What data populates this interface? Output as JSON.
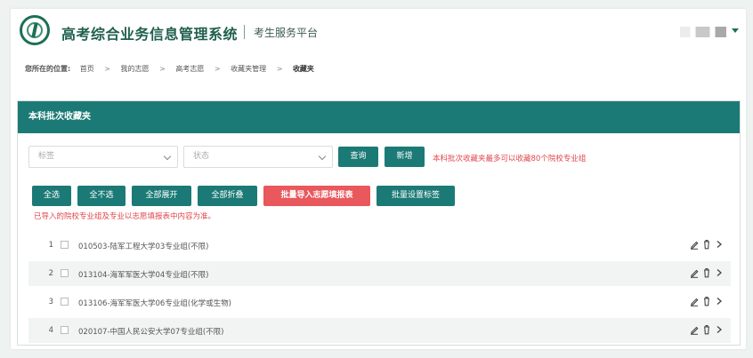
{
  "colors": {
    "accent": "#1c7a76",
    "title": "#1f5f4d",
    "danger": "#e8585d",
    "hint": "#e0464b"
  },
  "header": {
    "title": "高考综合业务信息管理系统",
    "subtitle": "考生服务平台",
    "logo_icon": "emblem-logo",
    "user_menu_icon": "caret-down-icon"
  },
  "breadcrumb": {
    "prefix": "您所在的位置:",
    "items": [
      "首页",
      "我的志愿",
      "高考志愿",
      "收藏夹管理",
      "收藏夹"
    ],
    "separator": ">"
  },
  "panel": {
    "title": "本科批次收藏夹",
    "filters": {
      "tag_placeholder": "标签",
      "status_placeholder": "状态"
    },
    "query_button": "查询",
    "add_button": "新增",
    "limit_hint": "本科批次收藏夹最多可以收藏80个院校专业组",
    "actions": [
      "全选",
      "全不选",
      "全部展开",
      "全部折叠",
      "批量导入志愿填报表",
      "批量设置标签"
    ],
    "import_hint": "已导入的院校专业组及专业以志愿填报表中内容为准。",
    "rows": [
      {
        "index": "1",
        "label": "010503-陆军工程大学03专业组(不限)"
      },
      {
        "index": "2",
        "label": "013104-海军军医大学04专业组(不限)"
      },
      {
        "index": "3",
        "label": "013106-海军军医大学06专业组(化学或生物)"
      },
      {
        "index": "4",
        "label": "020107-中国人民公安大学07专业组(不限)"
      }
    ],
    "row_icons": [
      "edit-icon",
      "trash-icon",
      "chevron-right-icon"
    ]
  }
}
